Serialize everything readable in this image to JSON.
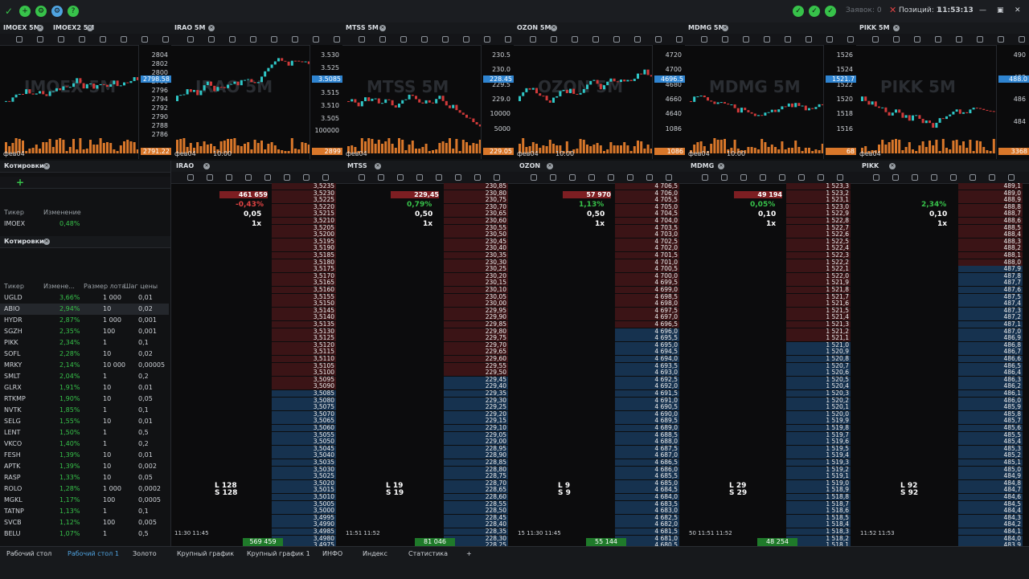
{
  "topbar": {
    "orders_label": "Заявок: 0",
    "positions_label": "Позиций: 1",
    "clock": "11:53:13"
  },
  "charts": [
    {
      "tabs": [
        "IMOEX 5M",
        "IMOEX2 5M"
      ],
      "wm": "IMOEX 5M",
      "ticks": [
        "2804",
        "2802",
        "2800",
        "2798",
        "2796",
        "2794",
        "2792",
        "2790",
        "2788",
        "2786"
      ],
      "tag": "2798.58",
      "tag2": "2791.22",
      "xlabels": [
        "фев04"
      ]
    },
    {
      "tabs": [
        "IRAO 5M"
      ],
      "wm": "IRAO 5M",
      "ticks": [
        "3.530",
        "3.525",
        "3.520",
        "3.515",
        "3.510",
        "3.505",
        "100000"
      ],
      "tag": "3.5085",
      "tag2": "2899",
      "xlabels": [
        "фев04",
        "10:00"
      ]
    },
    {
      "tabs": [
        "MTSS 5M"
      ],
      "wm": "MTSS 5M",
      "ticks": [
        "230.5",
        "230.0",
        "229.5",
        "229.0",
        "10000",
        "5000"
      ],
      "tag": "228.45",
      "tag2": "229.05",
      "xlabels": [
        "фев04"
      ]
    },
    {
      "tabs": [
        "OZON 5M"
      ],
      "wm": "OZON 5M",
      "ticks": [
        "4720",
        "4700",
        "4680",
        "4660",
        "4640",
        "1086"
      ],
      "tag": "4696.5",
      "tag2": "1086",
      "xlabels": [
        "фев04",
        "10:00"
      ]
    },
    {
      "tabs": [
        "MDMG 5M"
      ],
      "wm": "MDMG 5M",
      "ticks": [
        "1526",
        "1524",
        "1522",
        "1520",
        "1518",
        "1516"
      ],
      "tag": "1521.7",
      "tag2": "68",
      "xlabels": [
        "фев04",
        "10:00"
      ]
    },
    {
      "tabs": [
        "PIKK 5M"
      ],
      "wm": "PIKK 5M",
      "ticks": [
        "490",
        "488",
        "486",
        "484"
      ],
      "tag": "488.0",
      "tag2": "3368",
      "xlabels": [
        "фев04"
      ]
    }
  ],
  "quotes_top": {
    "title": "Котировки",
    "col_ticker": "Тикер",
    "col_change": "Изменение",
    "rows": [
      {
        "ticker": "IMOEX",
        "change": "0,48%"
      }
    ]
  },
  "quotes": {
    "title": "Котировки",
    "cols": [
      "Тикер",
      "Измене...",
      "Размер лота",
      "Шаг цены"
    ],
    "rows": [
      {
        "t": "UGLD",
        "c": "3,66%",
        "l": "1 000",
        "s": "0,01"
      },
      {
        "t": "ABIO",
        "c": "2,94%",
        "l": "10",
        "s": "0,02"
      },
      {
        "t": "HYDR",
        "c": "2,87%",
        "l": "1 000",
        "s": "0,001"
      },
      {
        "t": "SGZH",
        "c": "2,35%",
        "l": "100",
        "s": "0,001"
      },
      {
        "t": "PIKK",
        "c": "2,34%",
        "l": "1",
        "s": "0,1"
      },
      {
        "t": "SOFL",
        "c": "2,28%",
        "l": "10",
        "s": "0,02"
      },
      {
        "t": "MRKY",
        "c": "2,14%",
        "l": "10 000",
        "s": "0,00005"
      },
      {
        "t": "SMLT",
        "c": "2,04%",
        "l": "1",
        "s": "0,2"
      },
      {
        "t": "GLRX",
        "c": "1,91%",
        "l": "10",
        "s": "0,01"
      },
      {
        "t": "RTKMP",
        "c": "1,90%",
        "l": "10",
        "s": "0,05"
      },
      {
        "t": "NVTK",
        "c": "1,85%",
        "l": "1",
        "s": "0,1"
      },
      {
        "t": "SELG",
        "c": "1,55%",
        "l": "10",
        "s": "0,01"
      },
      {
        "t": "LENT",
        "c": "1,50%",
        "l": "1",
        "s": "0,5"
      },
      {
        "t": "VKCO",
        "c": "1,40%",
        "l": "1",
        "s": "0,2"
      },
      {
        "t": "FESH",
        "c": "1,39%",
        "l": "10",
        "s": "0,01"
      },
      {
        "t": "APTK",
        "c": "1,39%",
        "l": "10",
        "s": "0,002"
      },
      {
        "t": "RASP",
        "c": "1,33%",
        "l": "10",
        "s": "0,05"
      },
      {
        "t": "ROLO",
        "c": "1,28%",
        "l": "1 000",
        "s": "0,0002"
      },
      {
        "t": "MGKL",
        "c": "1,17%",
        "l": "100",
        "s": "0,0005"
      },
      {
        "t": "TATNP",
        "c": "1,13%",
        "l": "1",
        "s": "0,1"
      },
      {
        "t": "SVCB",
        "c": "1,12%",
        "l": "100",
        "s": "0,005"
      },
      {
        "t": "BELU",
        "c": "1,07%",
        "l": "1",
        "s": "0,5"
      }
    ]
  },
  "panes": [
    {
      "name": "IRAO",
      "header": "461 659",
      "pct": "-0,43%",
      "lot": "0,05",
      "mult": "1x",
      "L": "L 128",
      "S": "S 128",
      "foot": "569 459",
      "time": "11:30  11:45",
      "asks": [
        "3,5235",
        "3,5230",
        "3,5225",
        "3,5220",
        "3,5215",
        "3,5210",
        "3,5205",
        "3,5200",
        "3,5195",
        "3,5190",
        "3,5185",
        "3,5180",
        "3,5175",
        "3,5170",
        "3,5165",
        "3,5160",
        "3,5155",
        "3,5150",
        "3,5145",
        "3,5140",
        "3,5135",
        "3,5130",
        "3,5125",
        "3,5120",
        "3,5115",
        "3,5110",
        "3,5105",
        "3,5100",
        "3,5095",
        "3,5090"
      ],
      "bids": [
        "3,5085",
        "3,5080",
        "3,5075",
        "3,5070",
        "3,5065",
        "3,5060",
        "3,5055",
        "3,5050",
        "3,5045",
        "3,5040",
        "3,5035",
        "3,5030",
        "3,5025",
        "3,5020",
        "3,5015",
        "3,5010",
        "3,5005",
        "3,5000",
        "3,4995",
        "3,4990",
        "3,4985",
        "3,4980",
        "3,4975",
        "3,4970",
        "3,4965"
      ]
    },
    {
      "name": "MTSS",
      "header": "229,45",
      "pct": "0,79%",
      "lot": "0,50",
      "mult": "1x",
      "L": "L 19",
      "S": "S 19",
      "foot": "81 046",
      "time": "11:51 11:52",
      "asks": [
        "230,85",
        "230,80",
        "230,75",
        "230,70",
        "230,65",
        "230,60",
        "230,55",
        "230,50",
        "230,45",
        "230,40",
        "230,35",
        "230,30",
        "230,25",
        "230,20",
        "230,15",
        "230,10",
        "230,05",
        "230,00",
        "229,95",
        "229,90",
        "229,85",
        "229,80",
        "229,75",
        "229,70",
        "229,65",
        "229,60",
        "229,55",
        "229,50"
      ],
      "bids": [
        "229,45",
        "229,40",
        "229,35",
        "229,30",
        "229,25",
        "229,20",
        "229,15",
        "229,10",
        "229,05",
        "229,00",
        "228,95",
        "228,90",
        "228,85",
        "228,80",
        "228,75",
        "228,70",
        "228,65",
        "228,60",
        "228,55",
        "228,50",
        "228,45",
        "228,40",
        "228,35",
        "228,30",
        "228,25",
        "228,20"
      ]
    },
    {
      "name": "OZON",
      "header": "57 970",
      "pct": "1,13%",
      "lot": "0,50",
      "mult": "1x",
      "L": "L 9",
      "S": "S 9",
      "foot": "55 144",
      "time": "15 11:30 11:45",
      "asks": [
        "4 706,5",
        "4 706,0",
        "4 705,5",
        "4 705,0",
        "4 704,5",
        "4 704,0",
        "4 703,5",
        "4 703,0",
        "4 702,5",
        "4 702,0",
        "4 701,5",
        "4 701,0",
        "4 700,5",
        "4 700,0",
        "4 699,5",
        "4 699,0",
        "4 698,5",
        "4 698,0",
        "4 697,5",
        "4 697,0",
        "4 696,5"
      ],
      "bids": [
        "4 696,0",
        "4 695,5",
        "4 695,0",
        "4 694,5",
        "4 694,0",
        "4 693,5",
        "4 693,0",
        "4 692,5",
        "4 692,0",
        "4 691,5",
        "4 691,0",
        "4 690,5",
        "4 690,0",
        "4 689,5",
        "4 689,0",
        "4 688,5",
        "4 688,0",
        "4 687,5",
        "4 687,0",
        "4 686,5",
        "4 686,0",
        "4 685,5",
        "4 685,0",
        "4 684,5",
        "4 684,0",
        "4 683,5",
        "4 683,0",
        "4 682,5",
        "4 682,0",
        "4 681,5",
        "4 681,0",
        "4 680,5",
        "4 680,0"
      ]
    },
    {
      "name": "MDMG",
      "header": "49 194",
      "pct": "0,05%",
      "lot": "0,10",
      "mult": "1x",
      "L": "L 29",
      "S": "S 29",
      "foot": "48 254",
      "time": "50 11:51 11:52",
      "asks": [
        "1 523,3",
        "1 523,2",
        "1 523,1",
        "1 523,0",
        "1 522,9",
        "1 522,8",
        "1 522,7",
        "1 522,6",
        "1 522,5",
        "1 522,4",
        "1 522,3",
        "1 522,2",
        "1 522,1",
        "1 522,0",
        "1 521,9",
        "1 521,8",
        "1 521,7",
        "1 521,6",
        "1 521,5",
        "1 521,4",
        "1 521,3",
        "1 521,2",
        "1 521,1"
      ],
      "bids": [
        "1 521,0",
        "1 520,9",
        "1 520,8",
        "1 520,7",
        "1 520,6",
        "1 520,5",
        "1 520,4",
        "1 520,3",
        "1 520,2",
        "1 520,1",
        "1 520,0",
        "1 519,9",
        "1 519,8",
        "1 519,7",
        "1 519,6",
        "1 519,5",
        "1 519,4",
        "1 519,3",
        "1 519,2",
        "1 519,1",
        "1 519,0",
        "1 518,9",
        "1 518,8",
        "1 518,7",
        "1 518,6",
        "1 518,5",
        "1 518,4",
        "1 518,3",
        "1 518,2",
        "1 518,1",
        "1 518,0"
      ]
    },
    {
      "name": "PIKK",
      "header": "",
      "pct": "2,34%",
      "lot": "0,10",
      "mult": "1x",
      "L": "L 92",
      "S": "S 92",
      "foot": "",
      "time": "11:52 11:53",
      "asks": [
        "489,1",
        "489,0",
        "488,9",
        "488,8",
        "488,7",
        "488,6",
        "488,5",
        "488,4",
        "488,3",
        "488,2",
        "488,1",
        "488,0"
      ],
      "bids": [
        "487,9",
        "487,8",
        "487,7",
        "487,6",
        "487,5",
        "487,4",
        "487,3",
        "487,2",
        "487,1",
        "487,0",
        "486,9",
        "486,8",
        "486,7",
        "486,6",
        "486,5",
        "486,4",
        "486,3",
        "486,2",
        "486,1",
        "486,0",
        "485,9",
        "485,8",
        "485,7",
        "485,6",
        "485,5",
        "485,4",
        "485,3",
        "485,2",
        "485,1",
        "485,0",
        "484,9",
        "484,8",
        "484,7",
        "484,6",
        "484,5",
        "484,4",
        "484,3",
        "484,2",
        "484,1",
        "484,0",
        "483,9",
        "483,8",
        "483,7"
      ]
    }
  ],
  "bottom_tabs": [
    "Рабочий стол",
    "Рабочий стол 1",
    "Золото",
    "Крупный график",
    "Крупный график 1",
    "ИНФО",
    "Индекс",
    "Статистика",
    "+"
  ]
}
